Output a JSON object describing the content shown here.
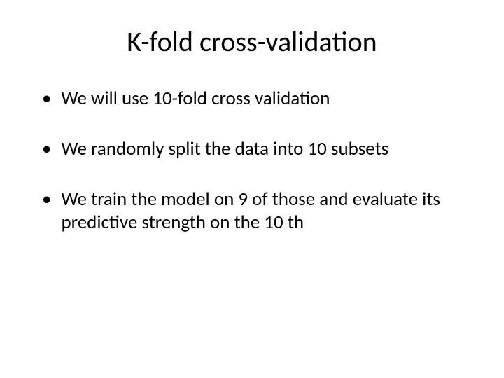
{
  "slide": {
    "title": "K-fold cross-validation",
    "bullets": [
      "We will use 10-fold cross validation",
      "We randomly split the data into 10 subsets",
      "We train the model on 9 of those and evaluate its predictive strength on the 10 th"
    ],
    "bullet_marker": "•"
  }
}
